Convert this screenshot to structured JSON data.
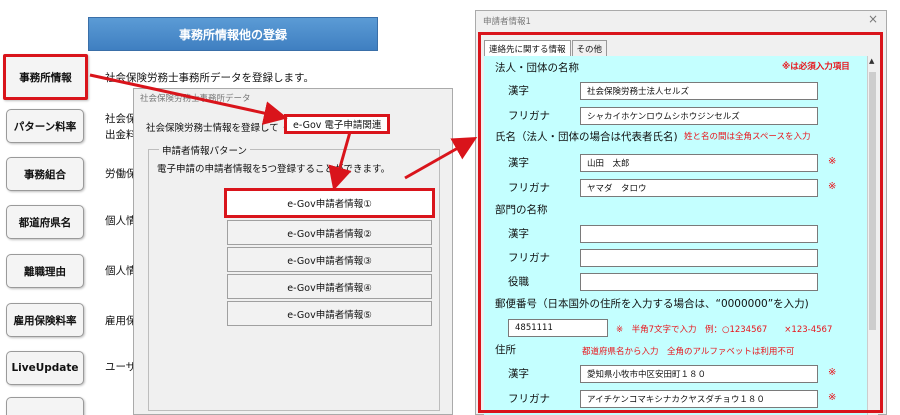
{
  "main": {
    "header_title": "事務所情報他の登録",
    "buttons": [
      {
        "label": "事務所情報",
        "desc": "社会保険労務士事務所データを登録します。"
      },
      {
        "label": "パターン料率",
        "desc": "社会保",
        "desc2": "出金料"
      },
      {
        "label": "事務組合",
        "desc": "労働保"
      },
      {
        "label": "都道府県名",
        "desc": "個人情"
      },
      {
        "label": "離職理由",
        "desc": "個人情"
      },
      {
        "label": "雇用保険料率",
        "desc": "雇用保"
      },
      {
        "label": "LiveUpdate",
        "desc": "ユーザ"
      }
    ]
  },
  "dialog": {
    "title": "社会保険労務士事務所データ",
    "tab_a": "社会保険労務士情報を登録して ください",
    "tab_b": "e-Gov 電子申請関連",
    "group_legend": "申請者情報パターン",
    "group_desc": "電子申請の申請者情報を5つ登録することができます。",
    "buttons": [
      "e-Gov申請者情報①",
      "e-Gov申請者情報②",
      "e-Gov申請者情報③",
      "e-Gov申請者情報④",
      "e-Gov申請者情報⑤"
    ]
  },
  "form": {
    "title": "申請者情報1",
    "close": "×",
    "tabs": [
      "連絡先に関する情報",
      "その他"
    ],
    "required_note": "※は必須入力項目",
    "corp_section": "法人・団体の名称",
    "kanji_label": "漢字",
    "kana_label": "フリガナ",
    "corp_kanji": "社会保険労務士法人セルズ",
    "corp_kana": "シャカイホケンロウムシホウジンセルズ",
    "name_section": "氏名（法人・団体の場合は代表者氏名)",
    "name_note": "姓と名の間は全角スペースを入力",
    "name_kanji": "山田　太郎",
    "name_kana": "ヤマダ　タロウ",
    "dept_section": "部門の名称",
    "role_label": "役職",
    "dept_kanji": "",
    "dept_kana": "",
    "role_value": "",
    "postal_section": "郵便番号（日本国外の住所を入力する場合は、“0000000”を入力)",
    "postal_value": "4851111",
    "postal_note": "※　半角7文字で入力　例：○1234567　　×123-4567",
    "address_section": "住所",
    "address_note": "都道府県名から入力　全角のアルファベットは利用不可",
    "addr_kanji": "愛知県小牧市中区安田町１８０",
    "addr_kana": "アイチケンコマキシナカクヤスダチョウ１８０",
    "mark": "※"
  },
  "colors": {
    "highlight": "#d9141b",
    "form_bg": "#c4ffff",
    "header": "#4a8ccf"
  }
}
